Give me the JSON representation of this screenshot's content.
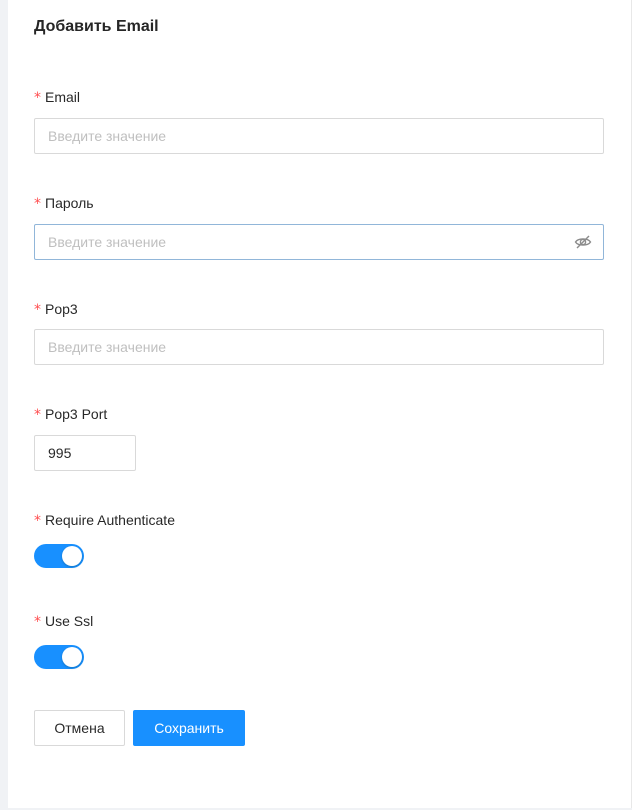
{
  "form": {
    "title": "Добавить Email",
    "required_mark": "*",
    "email": {
      "label": "Email",
      "value": "",
      "placeholder": "Введите значение"
    },
    "password": {
      "label": "Пароль",
      "value": "",
      "placeholder": "Введите значение",
      "toggle_icon": "eye-invisible-icon"
    },
    "pop3": {
      "label": "Pop3",
      "value": "",
      "placeholder": "Введите значение"
    },
    "pop3_port": {
      "label": "Pop3 Port",
      "value": "995"
    },
    "require_authenticate": {
      "label": "Require Authenticate",
      "checked": true
    },
    "use_ssl": {
      "label": "Use Ssl",
      "checked": true
    }
  },
  "actions": {
    "cancel_label": "Отмена",
    "save_label": "Сохранить"
  },
  "colors": {
    "primary": "#1890ff",
    "required": "#ff4d4f",
    "border": "#d9d9d9",
    "placeholder": "#bfbfbf"
  }
}
